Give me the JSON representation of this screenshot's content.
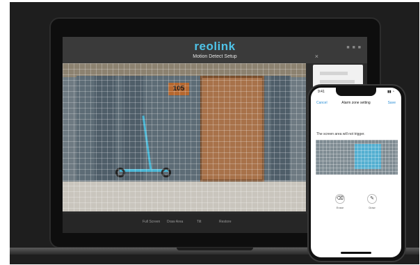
{
  "app": {
    "logo": "reolink",
    "dialog_title": "Motion Detect Setup",
    "close_symbol": "×",
    "window_controls": "■ ■ ■",
    "house_number": "105"
  },
  "toolbar": {
    "items": [
      "Full Screen",
      "Draw Area",
      "Tilt",
      "Restore"
    ]
  },
  "phone": {
    "time": "9:41",
    "status": "▮▮ ◔",
    "cancel": "Cancel",
    "title": "Alarm zone setting",
    "save": "Save",
    "note": "The screen area will not trigger.",
    "buttons": [
      {
        "icon": "eraser-icon",
        "glyph": "⌫",
        "label": "Erase"
      },
      {
        "icon": "pen-icon",
        "glyph": "✎",
        "label": "Draw"
      }
    ]
  },
  "colors": {
    "accent": "#4fc3e8",
    "ios_link": "#2b8fd6",
    "door": "#a8724a"
  }
}
